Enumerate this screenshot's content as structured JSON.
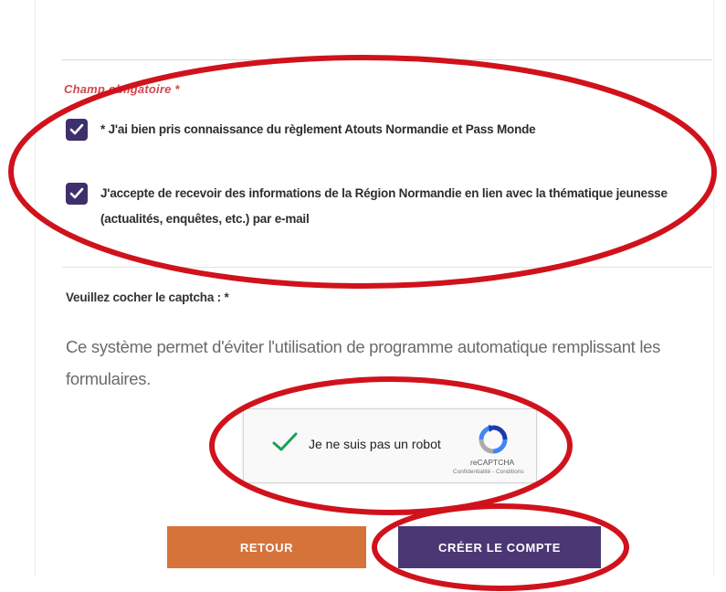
{
  "form": {
    "required_note": "Champ obligatoire *",
    "consent_rules": {
      "checked": true,
      "label": "* J'ai bien pris connaissance du règlement Atouts Normandie et Pass Monde"
    },
    "consent_info": {
      "checked": true,
      "label_line1": "J'accepte de recevoir des informations de la Région Normandie en lien avec la thématique jeunesse",
      "label_line2": "(actualités, enquêtes, etc.) par e-mail"
    },
    "captcha_title": "Veuillez cocher le captcha : *",
    "captcha_description": "Ce système permet d'éviter l'utilisation de programme automatique remplissant les formulaires.",
    "recaptcha": {
      "label": "Je ne suis pas un robot",
      "brand": "reCAPTCHA",
      "links": "Confidentialité - Conditions",
      "state": "checked"
    },
    "buttons": {
      "back": "RETOUR",
      "create": "CRÉER LE COMPTE"
    }
  },
  "colors": {
    "checkbox": "#3e2f6d",
    "required": "#d2484f",
    "back_button": "#d6733a",
    "create_button": "#4b3774",
    "annotation": "#d0121c",
    "recaptcha_check": "#1e9e57"
  }
}
